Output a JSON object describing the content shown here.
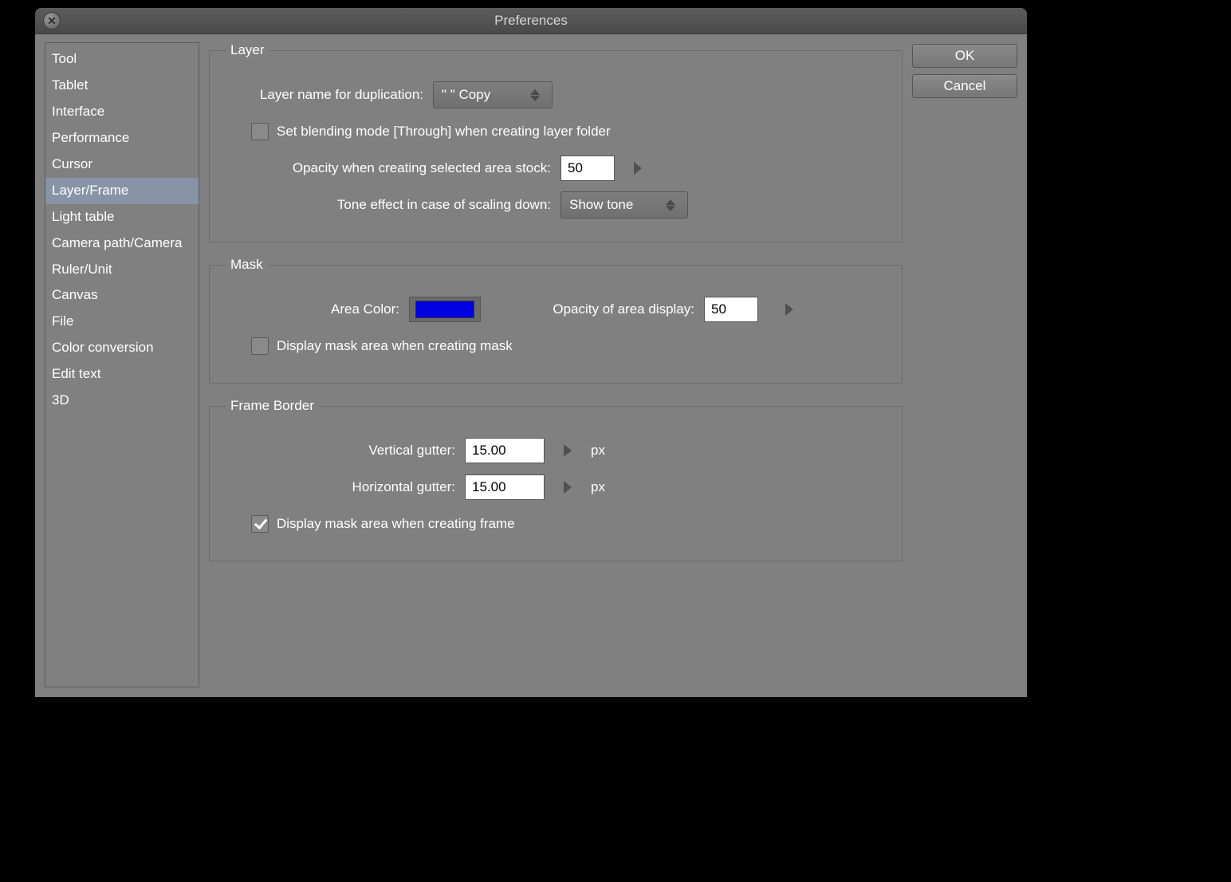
{
  "window": {
    "title": "Preferences"
  },
  "sidebar": {
    "items": [
      "Tool",
      "Tablet",
      "Interface",
      "Performance",
      "Cursor",
      "Layer/Frame",
      "Light table",
      "Camera path/Camera",
      "Ruler/Unit",
      "Canvas",
      "File",
      "Color conversion",
      "Edit text",
      "3D"
    ],
    "selected_index": 5
  },
  "buttons": {
    "ok": "OK",
    "cancel": "Cancel"
  },
  "layer": {
    "legend": "Layer",
    "dup_label": "Layer name for duplication:",
    "dup_value": "\"  \" Copy",
    "blend_through": "Set blending mode [Through] when creating layer folder",
    "blend_through_checked": false,
    "opacity_stock_label": "Opacity when creating selected area stock:",
    "opacity_stock_value": "50",
    "tone_label": "Tone effect in case of scaling down:",
    "tone_value": "Show tone"
  },
  "mask": {
    "legend": "Mask",
    "area_color_label": "Area Color:",
    "area_color": "#0000e0",
    "opacity_label": "Opacity of area display:",
    "opacity_value": "50",
    "display_mask": "Display mask area when creating mask",
    "display_mask_checked": false
  },
  "frame": {
    "legend": "Frame Border",
    "vgutter_label": "Vertical gutter:",
    "vgutter_value": "15.00",
    "hgutter_label": "Horizontal gutter:",
    "hgutter_value": "15.00",
    "unit": "px",
    "display_mask": "Display mask area when creating frame",
    "display_mask_checked": true
  }
}
